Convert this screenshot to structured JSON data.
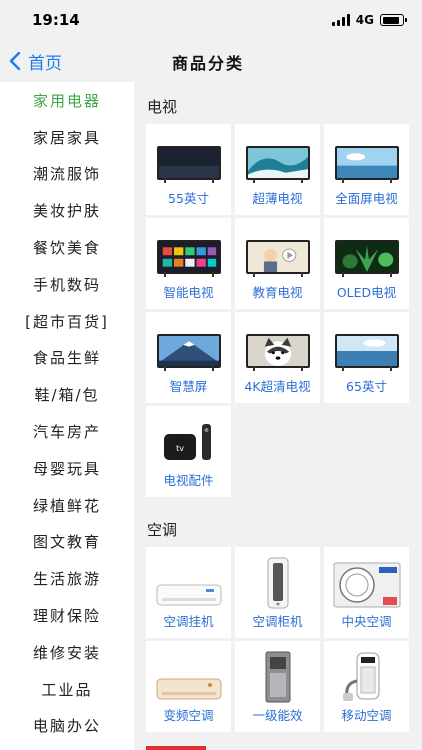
{
  "status": {
    "time": "19:14",
    "network": "4G",
    "battery_level": 0.9
  },
  "nav": {
    "back_label": "首页",
    "title": "商品分类"
  },
  "sidebar": {
    "active_index": 0,
    "items": [
      "家用电器",
      "家居家具",
      "潮流服饰",
      "美妆护肤",
      "餐饮美食",
      "手机数码",
      "[超市百货]",
      "食品生鲜",
      "鞋/箱/包",
      "汽车房产",
      "母婴玩具",
      "绿植鲜花",
      "图文教育",
      "生活旅游",
      "理财保险",
      "维修安装",
      "工业品",
      "电脑办公"
    ]
  },
  "sections": [
    {
      "title": "电视",
      "items": [
        {
          "label": "55英寸",
          "image": "dark-tv-icon"
        },
        {
          "label": "超薄电视",
          "image": "wave-tv-icon"
        },
        {
          "label": "全面屏电视",
          "image": "sky-tv-icon"
        },
        {
          "label": "智能电视",
          "image": "apps-tv-icon"
        },
        {
          "label": "教育电视",
          "image": "education-tv-icon"
        },
        {
          "label": "OLED电视",
          "image": "plant-tv-icon"
        },
        {
          "label": "智慧屏",
          "image": "mountain-tv-icon"
        },
        {
          "label": "4K超清电视",
          "image": "dog-tv-icon"
        },
        {
          "label": "65英寸",
          "image": "sea-tv-icon"
        },
        {
          "label": "电视配件",
          "image": "tv-box-icon"
        }
      ]
    },
    {
      "title": "空调",
      "items": [
        {
          "label": "空调挂机",
          "image": "wall-ac-icon"
        },
        {
          "label": "空调柜机",
          "image": "tower-ac-icon"
        },
        {
          "label": "中央空调",
          "image": "outdoor-ac-icon"
        },
        {
          "label": "变频空调",
          "image": "gold-ac-icon"
        },
        {
          "label": "一级能效",
          "image": "floor-ac-icon"
        },
        {
          "label": "移动空调",
          "image": "portable-ac-icon"
        }
      ]
    }
  ],
  "colors": {
    "accent_green": "#3aa845",
    "link_blue": "#2a6fd6",
    "nav_blue": "#1a7cf0"
  }
}
